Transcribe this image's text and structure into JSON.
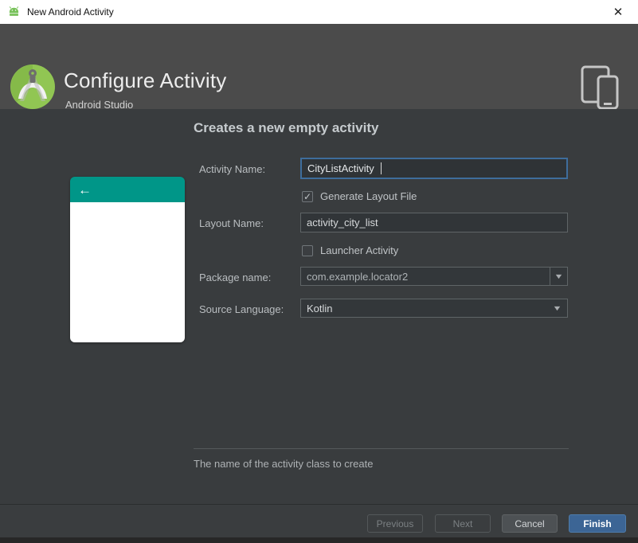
{
  "window": {
    "title": "New Android Activity",
    "close_glyph": "✕"
  },
  "header": {
    "title": "Configure Activity",
    "subtitle": "Android Studio"
  },
  "main": {
    "heading": "Creates a new empty activity",
    "preview": {
      "back_glyph": "←"
    },
    "form": {
      "activity_name": {
        "label": "Activity Name:",
        "value": "CityListActivity"
      },
      "generate_layout": {
        "label": "Generate Layout File",
        "checked": true,
        "check_glyph": "✓"
      },
      "layout_name": {
        "label": "Layout Name:",
        "value": "activity_city_list"
      },
      "launcher_activity": {
        "label": "Launcher Activity",
        "checked": false,
        "check_glyph": ""
      },
      "package_name": {
        "label": "Package name:",
        "value": "com.example.locator2",
        "arrow_glyph": "▼"
      },
      "source_language": {
        "label": "Source Language:",
        "value": "Kotlin",
        "arrow_glyph": "▼"
      }
    },
    "helper_text": "The name of the activity class to create"
  },
  "footer": {
    "previous_label": "Previous",
    "next_label": "Next",
    "cancel_label": "Cancel",
    "finish_label": "Finish"
  },
  "colors": {
    "accent_blue": "#3c6595",
    "focus_border": "#3e6d9c",
    "preview_teal": "#009688",
    "android_green": "#91c653",
    "header_gray": "#4b4b4b",
    "content_gray": "#393c3e"
  }
}
